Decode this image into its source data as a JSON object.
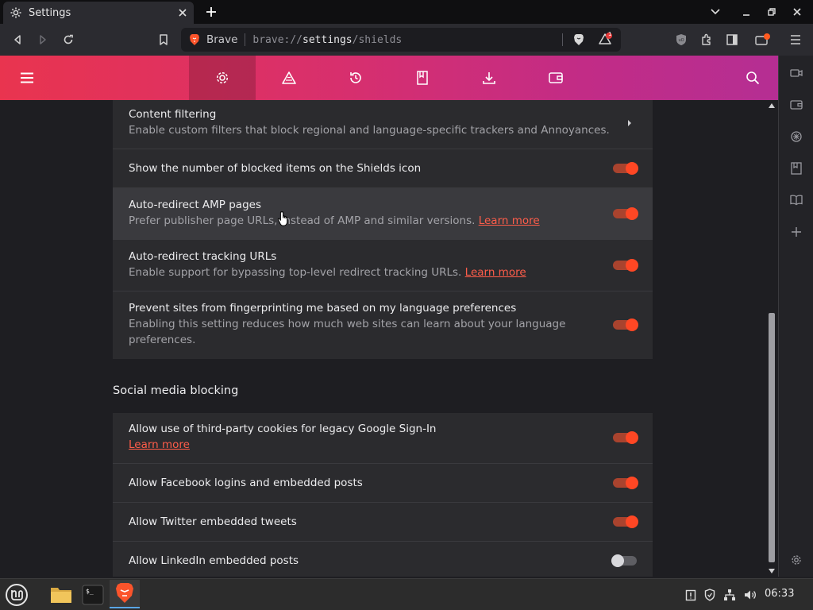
{
  "browser": {
    "tab_title": "Settings",
    "url_brand": "Brave",
    "url_scheme": "brave://",
    "url_host": "settings",
    "url_path": "/shields",
    "rewards_badge": "1"
  },
  "shields": {
    "rows": [
      {
        "label": "Content filtering",
        "sub": "Enable custom filters that block regional and language-specific trackers and Annoyances."
      },
      {
        "label": "Show the number of blocked items on the Shields icon"
      },
      {
        "label": "Auto-redirect AMP pages",
        "sub": "Prefer publisher page URLs, instead of AMP and similar versions.",
        "link": "Learn more"
      },
      {
        "label": "Auto-redirect tracking URLs",
        "sub": "Enable support for bypassing top-level redirect tracking URLs.",
        "link": "Learn more"
      },
      {
        "label": "Prevent sites from fingerprinting me based on my language preferences",
        "sub1": "Enabling this setting reduces how much web sites can learn about your language",
        "sub2": "preferences."
      }
    ]
  },
  "social": {
    "title": "Social media blocking",
    "rows": [
      {
        "label": "Allow use of third-party cookies for legacy Google Sign-In",
        "link": "Learn more"
      },
      {
        "label": "Allow Facebook logins and embedded posts"
      },
      {
        "label": "Allow Twitter embedded tweets"
      },
      {
        "label": "Allow LinkedIn embedded posts"
      }
    ]
  },
  "toggles": {
    "show_blocked_count": true,
    "amp_redirect": true,
    "tracking_url_redirect": true,
    "language_fingerprinting": true,
    "google_signin_cookies": true,
    "facebook": true,
    "twitter": true,
    "linkedin": false
  },
  "taskbar": {
    "clock": "06:33"
  },
  "colors": {
    "accent": "#ff4724",
    "header_gradient_start": "#e9344f",
    "header_gradient_end": "#b52e93",
    "link": "#ff5d4a"
  }
}
